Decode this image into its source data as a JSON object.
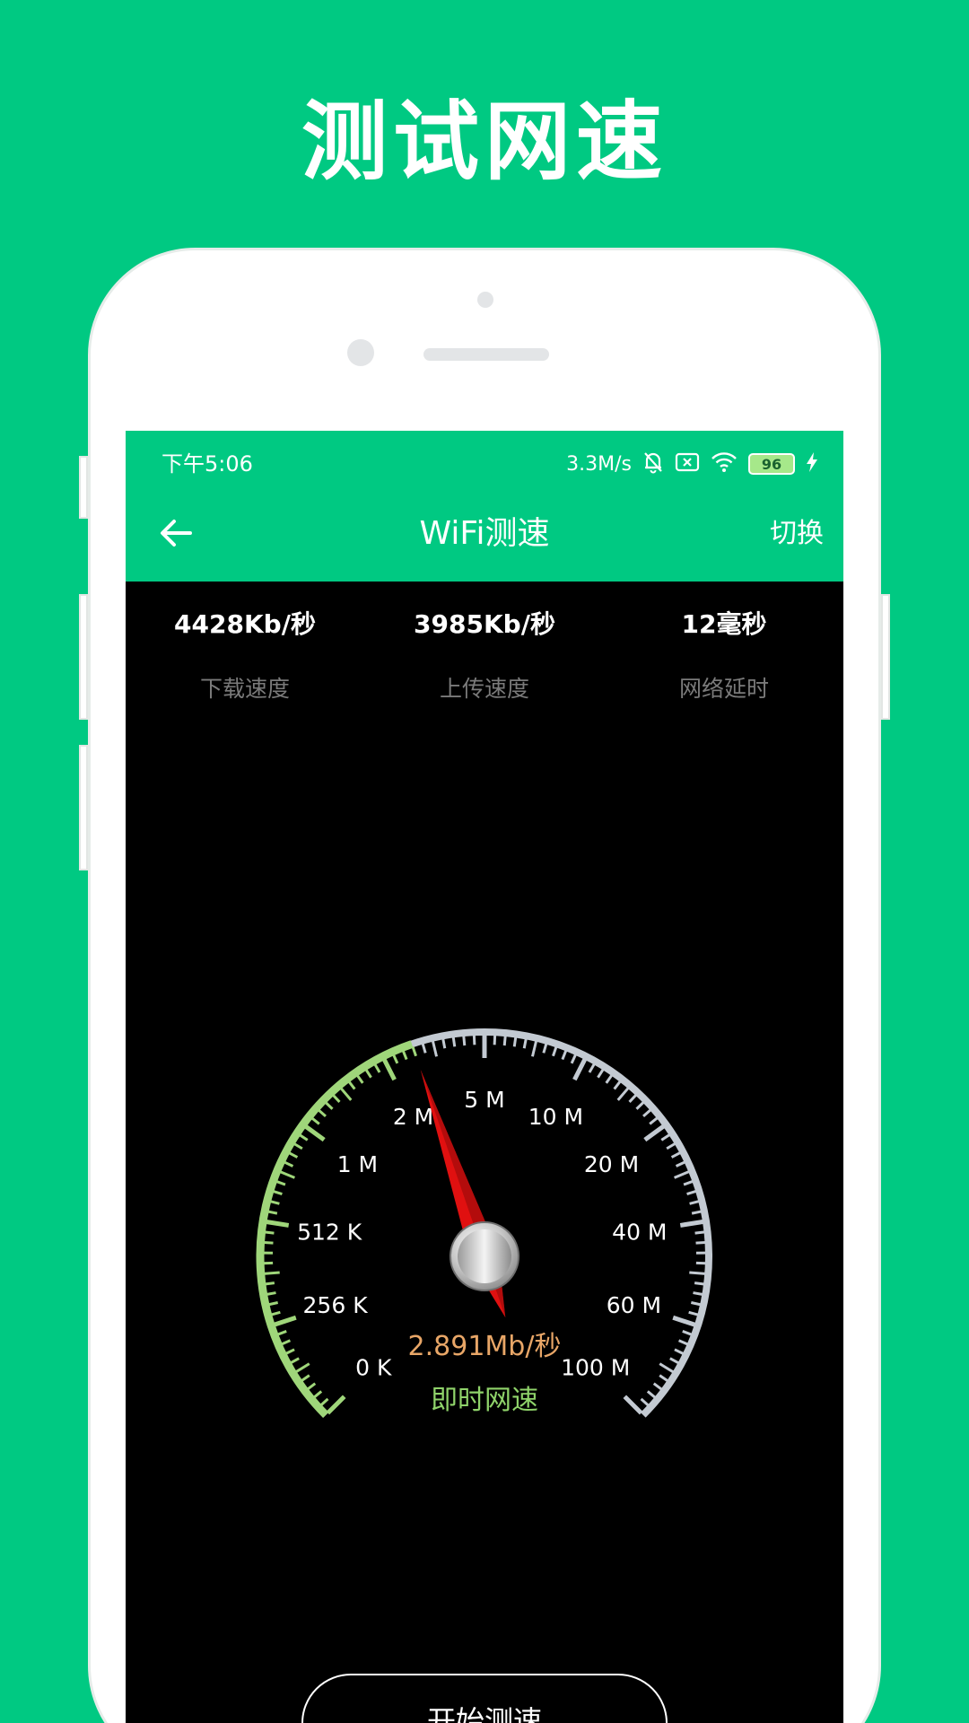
{
  "promo": {
    "title": "测试网速"
  },
  "status_bar": {
    "time": "下午5:06",
    "net_speed": "3.3M/s",
    "battery": "96"
  },
  "header": {
    "title": "WiFi测速",
    "switch_label": "切换",
    "back_icon": "arrow-left-icon"
  },
  "stats": [
    {
      "value": "4428Kb/秒",
      "label": "下载速度"
    },
    {
      "value": "3985Kb/秒",
      "label": "上传速度"
    },
    {
      "value": "12毫秒",
      "label": "网络延时"
    }
  ],
  "gauge": {
    "scale_labels": [
      "0 K",
      "256 K",
      "512 K",
      "1 M",
      "2 M",
      "5 M",
      "10 M",
      "20 M",
      "40 M",
      "60 M",
      "100 M"
    ],
    "current_reading": "2.891Mb/秒",
    "caption": "即时网速",
    "needle_scale_position": 4.3,
    "progress_scale_position": 4.3,
    "colors": {
      "progress": "#9fd67a",
      "track": "#c3cad2",
      "reading": "#e8a667",
      "caption": "#8fd36a",
      "needle": "#e01010"
    }
  },
  "actions": {
    "start_label": "开始测速"
  },
  "colors": {
    "brand": "#00c982"
  }
}
